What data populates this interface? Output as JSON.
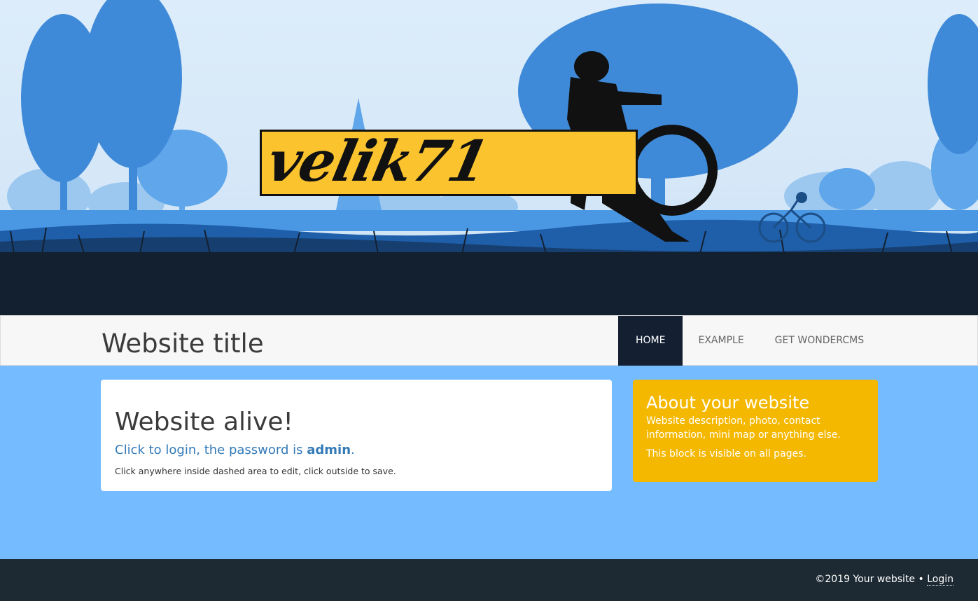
{
  "banner": {
    "logo_text": "velik71"
  },
  "header": {
    "site_title": "Website title",
    "nav": [
      {
        "label": "HOME",
        "active": true
      },
      {
        "label": "EXAMPLE",
        "active": false
      },
      {
        "label": "GET WONDERCMS",
        "active": false
      }
    ]
  },
  "main": {
    "heading": "Website alive!",
    "login_prefix": "Click to login, the password is ",
    "login_password": "admin",
    "login_suffix": ".",
    "edit_hint": "Click anywhere inside dashed area to edit, click outside to save."
  },
  "sidebar": {
    "heading": "About your website",
    "description": "Website description, photo, contact information, mini map or anything else.",
    "note": "This block is visible on all pages."
  },
  "footer": {
    "copyright": "©2019 Your website",
    "separator": " • ",
    "login_label": "Login"
  },
  "colors": {
    "page_bg": "#74bbff",
    "nav_active_bg": "#142032",
    "sidebar_bg": "#f5b800",
    "footer_bg": "#1d2a33",
    "link": "#337ab7",
    "logo_bg": "#fbc42f"
  }
}
